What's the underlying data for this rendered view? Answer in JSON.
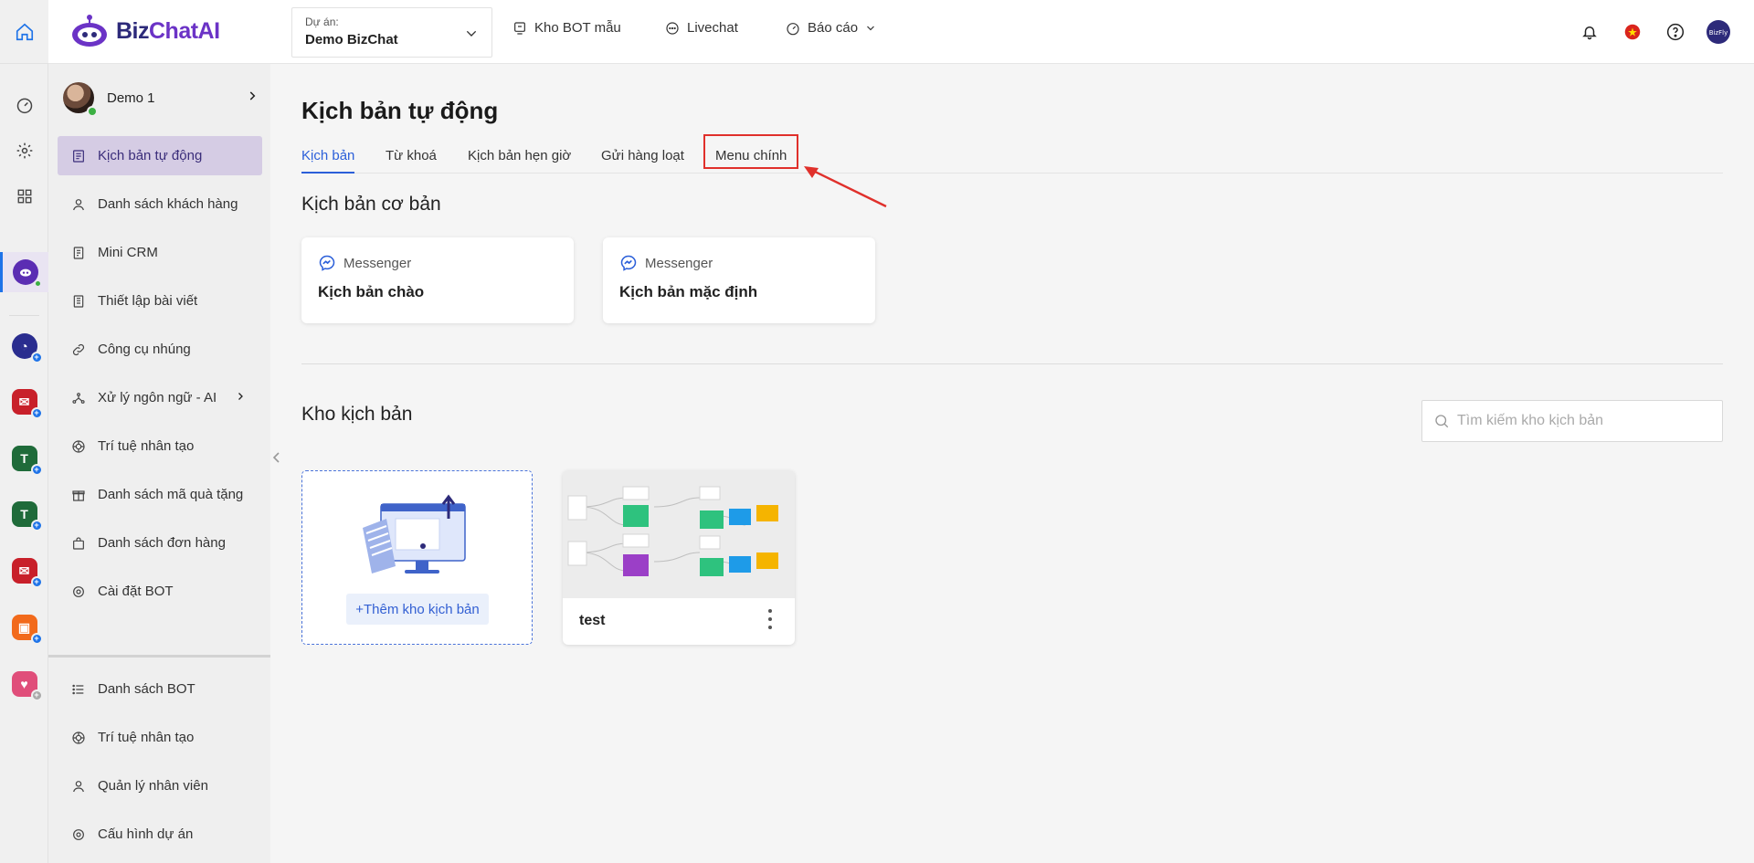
{
  "header": {
    "logo_text_a": "Biz",
    "logo_text_b": "ChatAI",
    "project_label": "Dự án:",
    "project_value": "Demo BizChat",
    "nav": [
      {
        "label": "Kho BOT mẫu"
      },
      {
        "label": "Livechat"
      },
      {
        "label": "Báo cáo"
      }
    ]
  },
  "sidebar": {
    "user_name": "Demo 1",
    "items": [
      {
        "label": "Kịch bản tự động",
        "icon": "script-icon",
        "active": true
      },
      {
        "label": "Danh sách khách hàng",
        "icon": "user-icon"
      },
      {
        "label": "Mini CRM",
        "icon": "crm-icon"
      },
      {
        "label": "Thiết lập bài viết",
        "icon": "post-icon"
      },
      {
        "label": "Công cụ nhúng",
        "icon": "link-icon"
      },
      {
        "label": "Xử lý ngôn ngữ - AI",
        "icon": "nlp-icon"
      },
      {
        "label": "Trí tuệ nhân tạo",
        "icon": "ai-icon"
      },
      {
        "label": "Danh sách mã quà tặng",
        "icon": "gift-icon"
      },
      {
        "label": "Danh sách đơn hàng",
        "icon": "bag-icon"
      },
      {
        "label": "Cài đặt BOT",
        "icon": "gear-icon"
      }
    ],
    "bottom_items": [
      {
        "label": "Danh sách BOT",
        "icon": "list-icon"
      },
      {
        "label": "Trí tuệ nhân tạo",
        "icon": "ai-icon"
      },
      {
        "label": "Quản lý nhân viên",
        "icon": "user-icon"
      },
      {
        "label": "Cấu hình dự án",
        "icon": "gear-icon"
      }
    ]
  },
  "main": {
    "title": "Kịch bản tự động",
    "tabs": [
      {
        "label": "Kịch bản",
        "active": true
      },
      {
        "label": "Từ khoá"
      },
      {
        "label": "Kịch bản hẹn giờ"
      },
      {
        "label": "Gửi hàng loạt"
      },
      {
        "label": "Menu chính",
        "highlighted": true
      }
    ],
    "basic_section_title": "Kịch bản cơ bản",
    "basic_cards": [
      {
        "channel": "Messenger",
        "title": "Kịch bản chào"
      },
      {
        "channel": "Messenger",
        "title": "Kịch bản mặc định"
      }
    ],
    "store_section_title": "Kho kịch bản",
    "search_placeholder": "Tìm kiếm kho kịch bản",
    "add_label": "+Thêm kho kịch bản",
    "templates": [
      {
        "name": "test"
      }
    ]
  },
  "colors": {
    "accent": "#2b5fd9",
    "brand": "#6b33c6",
    "highlight_box": "#e0302b",
    "active_menu_bg": "#d5cce4"
  }
}
